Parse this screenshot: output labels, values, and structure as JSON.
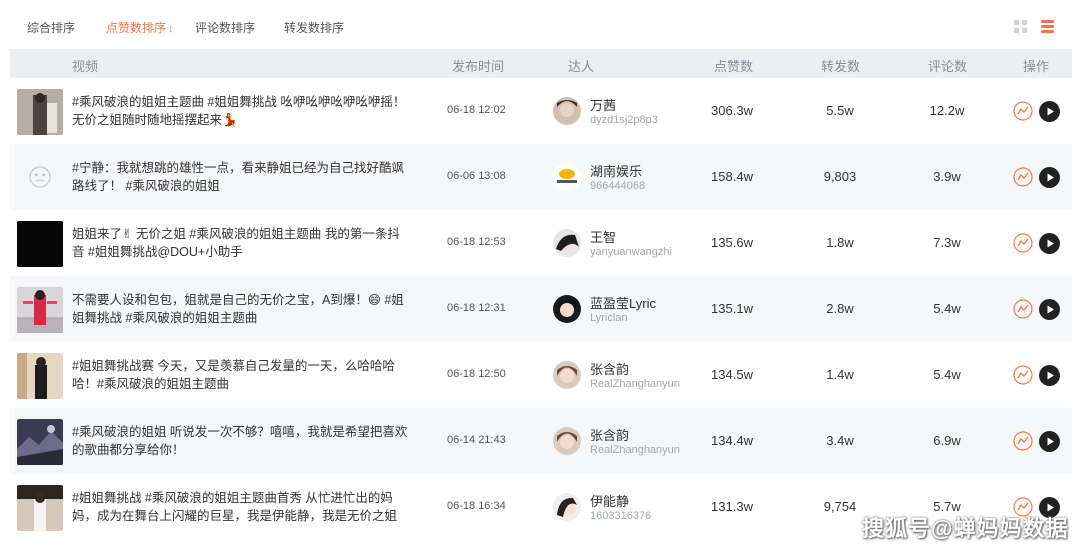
{
  "sort_tabs": [
    {
      "label": "综合排序",
      "active": false
    },
    {
      "label": "点赞数排序",
      "active": true
    },
    {
      "label": "评论数排序",
      "active": false
    },
    {
      "label": "转发数排序",
      "active": false
    }
  ],
  "view_toggle": {
    "grid_icon": "grid-view-icon",
    "list_icon": "list-view-icon",
    "active": "list"
  },
  "columns": {
    "video": "视频",
    "publish_time": "发布时间",
    "creator": "达人",
    "likes": "点赞数",
    "shares": "转发数",
    "comments": "评论数",
    "actions": "操作"
  },
  "rows": [
    {
      "title": "#乘风破浪的姐姐主题曲 #姐姐舞挑战 吆咿吆咿吆咿吆咿摇！无价之姐随时随地摇摆起来💃",
      "time": "06-18 12:02",
      "creator_name": "万茜",
      "creator_id": "dyzd1sj2p8p3",
      "likes": "306.3w",
      "shares": "5.5w",
      "comments": "12.2w"
    },
    {
      "title": "#宁静：我就想跳的雄性一点，看来静姐已经为自己找好酷飒路线了！ #乘风破浪的姐姐",
      "time": "06-06 13:08",
      "creator_name": "湖南娱乐",
      "creator_id": "966444068",
      "likes": "158.4w",
      "shares": "9,803",
      "comments": "3.9w"
    },
    {
      "title": "姐姐来了✌ 无价之姐 #乘风破浪的姐姐主题曲 我的第一条抖音 #姐姐舞挑战@DOU+小助手",
      "time": "06-18 12:53",
      "creator_name": "王智",
      "creator_id": "yanyuanwangzhi",
      "likes": "135.6w",
      "shares": "1.8w",
      "comments": "7.3w"
    },
    {
      "title": "不需要人设和包包，姐就是自己的无价之宝，A到爆！😄 #姐姐舞挑战 #乘风破浪的姐姐主题曲",
      "time": "06-18 12:31",
      "creator_name": "蓝盈莹Lyric",
      "creator_id": "Lyriclan",
      "likes": "135.1w",
      "shares": "2.8w",
      "comments": "5.4w"
    },
    {
      "title": "#姐姐舞挑战赛 今天，又是羡慕自己发量的一天，么哈哈哈哈！#乘风破浪的姐姐主题曲",
      "time": "06-18 12:50",
      "creator_name": "张含韵",
      "creator_id": "RealZhanghanyun",
      "likes": "134.5w",
      "shares": "1.4w",
      "comments": "5.4w"
    },
    {
      "title": "#乘风破浪的姐姐 听说发一次不够？嘻嘻，我就是希望把喜欢的歌曲都分享给你！",
      "time": "06-14 21:43",
      "creator_name": "张含韵",
      "creator_id": "RealZhanghanyun",
      "likes": "134.4w",
      "shares": "3.4w",
      "comments": "6.9w"
    },
    {
      "title": "#姐姐舞挑战 #乘风破浪的姐姐主题曲首秀 从忙进忙出的妈妈，成为在舞台上闪耀的巨星，我是伊能静，我是无价之姐",
      "time": "06-18 16:34",
      "creator_name": "伊能静",
      "creator_id": "1603316376",
      "likes": "131.3w",
      "shares": "9,754",
      "comments": "5.7w"
    }
  ],
  "watermark": "搜狐号@蝉妈妈数据"
}
